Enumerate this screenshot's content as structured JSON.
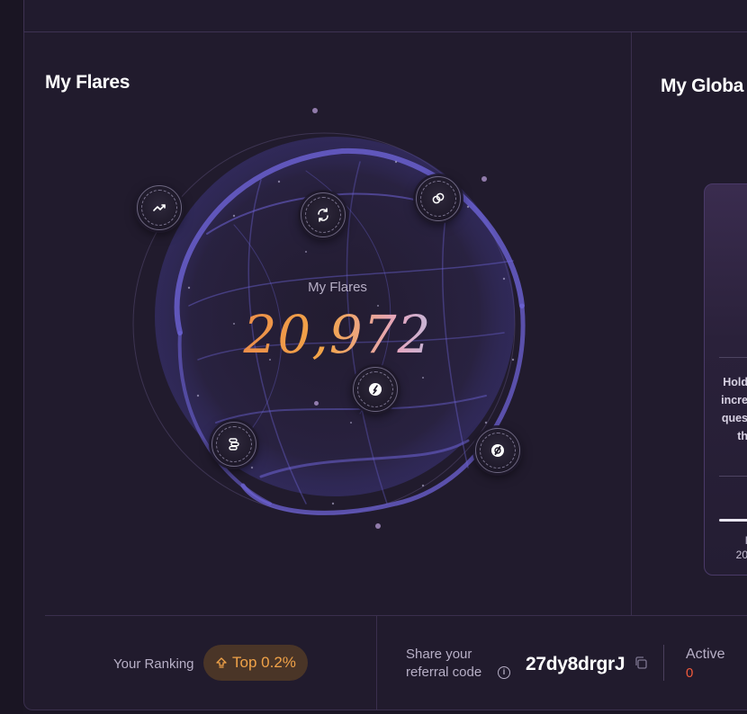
{
  "sections": {
    "flares_title": "My Flares",
    "global_title": "My Globa"
  },
  "flares": {
    "label": "My Flares",
    "value": "20,972"
  },
  "orbit_icons": [
    {
      "name": "trending-up-icon"
    },
    {
      "name": "refresh-icon"
    },
    {
      "name": "coins-link-icon"
    },
    {
      "name": "flare-badge-icon"
    },
    {
      "name": "stack-coins-icon"
    },
    {
      "name": "slash-coin-icon"
    }
  ],
  "right_card": {
    "lines": [
      "Hold",
      "incre",
      "ques",
      "th"
    ],
    "footer_lines": [
      "I",
      "20"
    ]
  },
  "ranking": {
    "label": "Your Ranking",
    "badge": "Top 0.2%"
  },
  "referral": {
    "label_line1": "Share your",
    "label_line2": "referral code",
    "code": "27dy8drgrJ",
    "info_icon": "i"
  },
  "active": {
    "label": "Active",
    "value": "0"
  },
  "colors": {
    "background": "#211b2d",
    "accent_orange": "#f0a248",
    "active_red": "#f05a3b",
    "globe_purple": "#6d63d6"
  }
}
